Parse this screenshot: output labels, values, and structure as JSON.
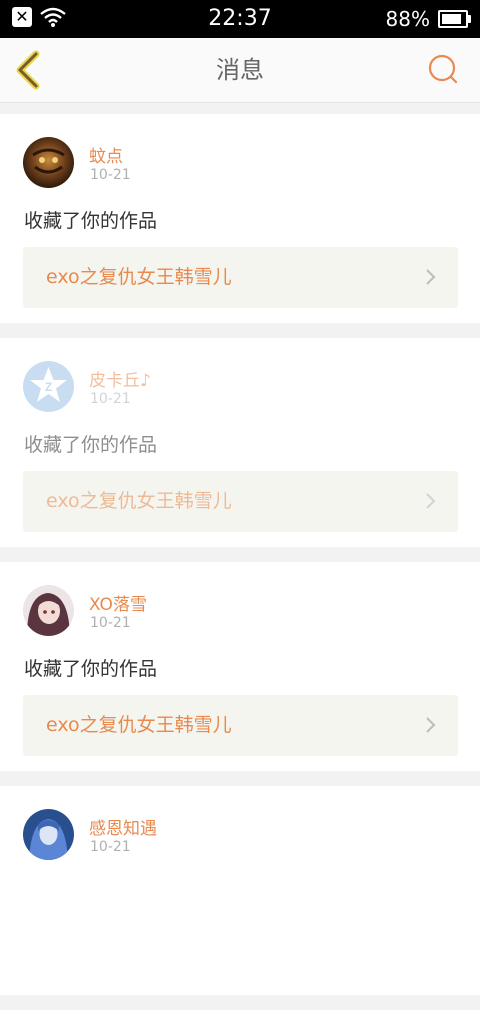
{
  "status_bar": {
    "time": "22:37",
    "battery_text": "88%",
    "battery_level": 0.88,
    "icons": [
      "close-notification-icon",
      "wifi-icon",
      "battery-icon"
    ]
  },
  "nav": {
    "title": "消息",
    "back_icon": "chevron-left-icon",
    "search_icon": "search-icon",
    "accent_color": "#e88a4e"
  },
  "messages": [
    {
      "user": "蚊点",
      "date": "10-21",
      "action": "收藏了你的作品",
      "work": "exo之复仇女王韩雪儿",
      "avatar": "tiger-avatar",
      "faded": false
    },
    {
      "user": "皮卡丘♪",
      "date": "10-21",
      "action": "收藏了你的作品",
      "work": "exo之复仇女王韩雪儿",
      "avatar": "qzone-star-avatar",
      "faded": true
    },
    {
      "user": "XO落雪",
      "date": "10-21",
      "action": "收藏了你的作品",
      "work": "exo之复仇女王韩雪儿",
      "avatar": "anime-girl-avatar",
      "faded": false
    },
    {
      "user": "感恩知遇",
      "date": "10-21",
      "action": "",
      "work": "",
      "avatar": "blue-girl-avatar",
      "faded": false
    }
  ]
}
